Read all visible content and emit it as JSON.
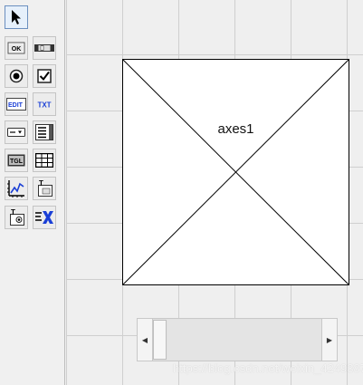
{
  "palette": {
    "tools": [
      {
        "name": "select-tool",
        "icon": "arrow-pointer-icon"
      },
      {
        "name": "push-button-tool",
        "icon": "push-button-icon",
        "label": "OK"
      },
      {
        "name": "slider-tool",
        "icon": "slider-icon"
      },
      {
        "name": "radio-button-tool",
        "icon": "radio-button-icon"
      },
      {
        "name": "check-box-tool",
        "icon": "check-box-icon"
      },
      {
        "name": "edit-text-tool",
        "icon": "edit-text-icon",
        "label": "EDIT"
      },
      {
        "name": "static-text-tool",
        "icon": "static-text-icon",
        "label": "TXT"
      },
      {
        "name": "popup-menu-tool",
        "icon": "popup-menu-icon"
      },
      {
        "name": "list-box-tool",
        "icon": "list-box-icon"
      },
      {
        "name": "toggle-button-tool",
        "icon": "toggle-button-icon",
        "label": "TGL"
      },
      {
        "name": "table-tool",
        "icon": "table-icon"
      },
      {
        "name": "axes-tool",
        "icon": "axes-icon"
      },
      {
        "name": "panel-tool",
        "icon": "panel-icon",
        "label": "T"
      },
      {
        "name": "button-group-tool",
        "icon": "button-group-icon",
        "label": "T"
      },
      {
        "name": "activex-tool",
        "icon": "activex-icon"
      }
    ]
  },
  "canvas": {
    "axes_label": "axes1",
    "watermark": "https://blog.csdn.net/weixin_42493873"
  },
  "colors": {
    "selected_tool": "#e6f0fb",
    "grid_line": "#cfcfcf",
    "activex_blue": "#1a3fd6"
  }
}
